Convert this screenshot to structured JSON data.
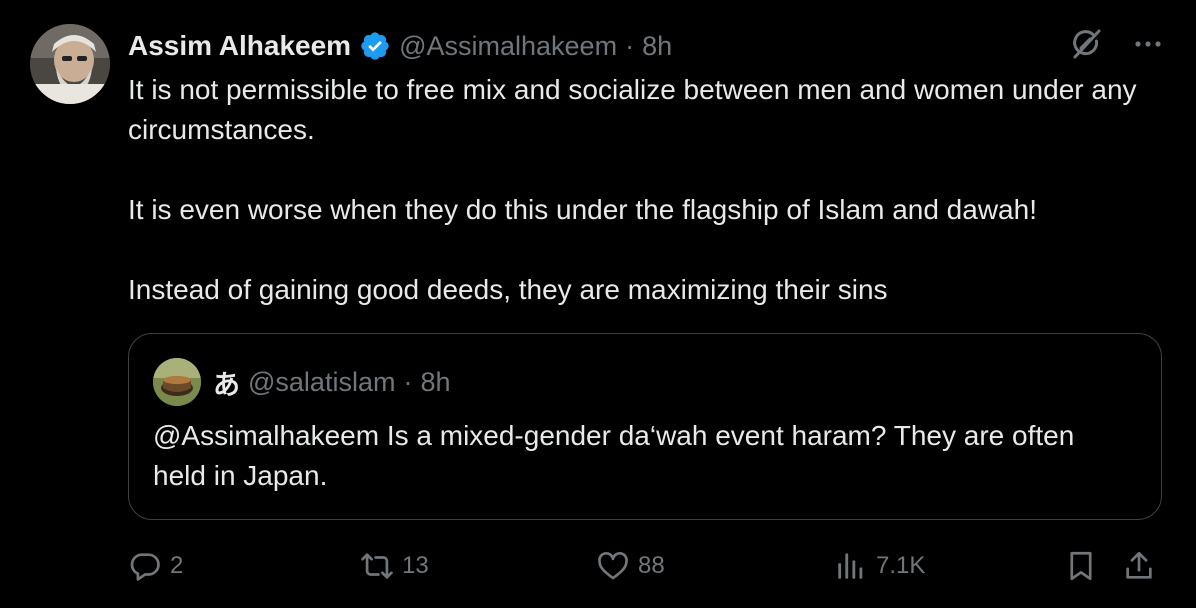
{
  "author": {
    "name": "Assim Alhakeem",
    "handle": "@Assimalhakeem",
    "separator": "·",
    "time": "8h",
    "verified": true,
    "verified_color": "#1d9bf0"
  },
  "tweet": {
    "paragraph1": "It is not permissible to free mix and socialize between men and women under any circumstances.",
    "paragraph2": "It is even worse when they do this under the flagship of Islam and dawah!",
    "paragraph3": "Instead of gaining good deeds, they are maximizing their sins"
  },
  "quoted": {
    "name": "あ",
    "handle": "@salatislam",
    "separator": "·",
    "time": "8h",
    "text": "@Assimalhakeem Is a mixed-gender da‘wah event haram? They are often held in Japan."
  },
  "actions": {
    "replies": "2",
    "reposts": "13",
    "likes": "88",
    "views": "7.1K"
  },
  "icons": {
    "top": [
      "grok-icon",
      "more-icon"
    ],
    "bar": [
      "reply-icon",
      "repost-icon",
      "like-icon",
      "views-icon",
      "bookmark-icon",
      "share-icon"
    ]
  },
  "colors": {
    "background": "#000000",
    "text": "#e7e9ea",
    "muted": "#71767b",
    "border": "#3e4144"
  }
}
